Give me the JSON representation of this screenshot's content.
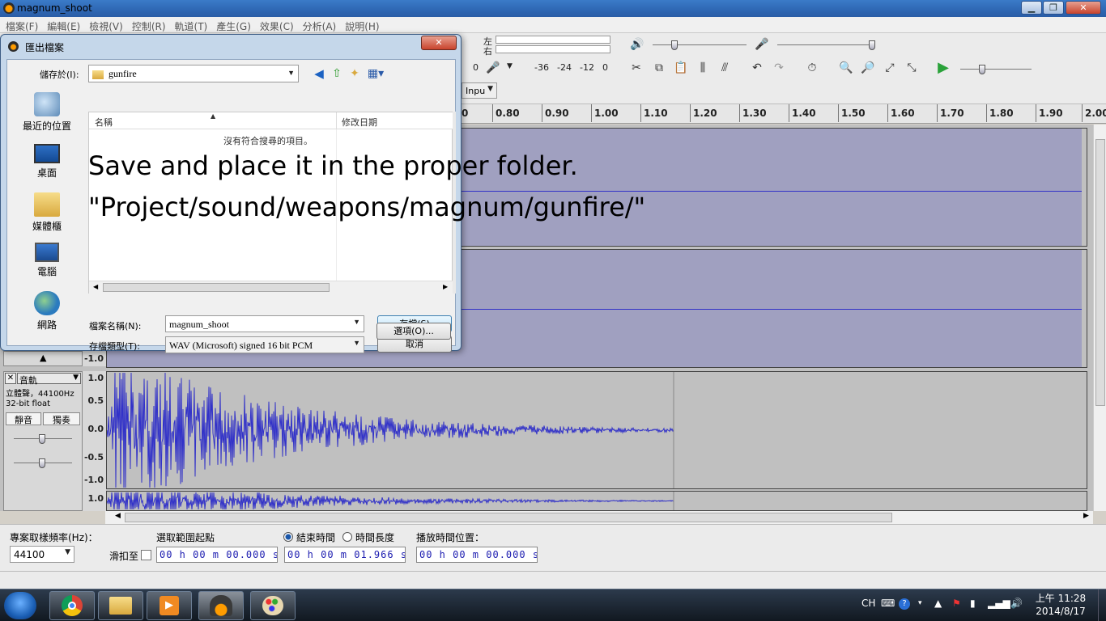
{
  "window": {
    "title": "magnum_shoot"
  },
  "menu": [
    "檔案(F)",
    "編輯(E)",
    "檢視(V)",
    "控制(R)",
    "軌道(T)",
    "產生(G)",
    "效果(C)",
    "分析(A)",
    "說明(H)"
  ],
  "toolbar": {
    "channel_left": "左",
    "channel_right": "右",
    "meter_labels": [
      "0",
      "-36",
      "-24",
      "-12",
      "0"
    ],
    "input_select": "Inpu"
  },
  "timeline": {
    "ticks": [
      "0",
      "0.80",
      "0.90",
      "1.00",
      "1.10",
      "1.20",
      "1.30",
      "1.40",
      "1.50",
      "1.60",
      "1.70",
      "1.80",
      "1.90",
      "2.00"
    ]
  },
  "tracks": {
    "upper_scale_bottom": "-1.0",
    "name": "音軌",
    "info_line1": "立體聲，44100Hz",
    "info_line2": "32-bit float",
    "mute": "靜音",
    "solo": "獨奏",
    "scale": [
      "1.0",
      "0.5",
      "0.0",
      "-0.5",
      "-1.0",
      "1.0"
    ],
    "close": "✕"
  },
  "selection_bar": {
    "rate_label": "專案取樣頻率(Hz)：",
    "rate_value": "44100",
    "snap_label": "滑扣至",
    "start_label": "選取範圍起點",
    "end_label": "結束時間",
    "length_label": "時間長度",
    "pos_label": "播放時間位置：",
    "start_value": "00 h 00 m 00.000 s",
    "end_value": "00 h 00 m 01.966 s",
    "pos_value": "00 h 00 m 00.000 s"
  },
  "dialog": {
    "title": "匯出檔案",
    "save_in_label": "儲存於(I):",
    "folder": "gunfire",
    "col_name": "名稱",
    "col_date": "修改日期",
    "empty_msg": "沒有符合搜尋的項目。",
    "places": [
      "最近的位置",
      "桌面",
      "媒體櫃",
      "電腦",
      "網路"
    ],
    "filename_label": "檔案名稱(N):",
    "filename_value": "magnum_shoot",
    "filetype_label": "存檔類型(T):",
    "filetype_value": "WAV (Microsoft) signed 16 bit PCM",
    "save_btn": "存檔(S)",
    "cancel_btn": "取消",
    "options_btn": "選項(O)..."
  },
  "overlay": {
    "line1": "Save and place it in the proper folder.",
    "line2": "\"Project/sound/weapons/magnum/gunfire/\""
  },
  "taskbar": {
    "lang": "CH",
    "time": "上午 11:28",
    "date": "2014/8/17"
  },
  "colors": {
    "waveform": "#3232c8",
    "selection": "#a0a0c0",
    "accent": "#3c7fb1"
  }
}
